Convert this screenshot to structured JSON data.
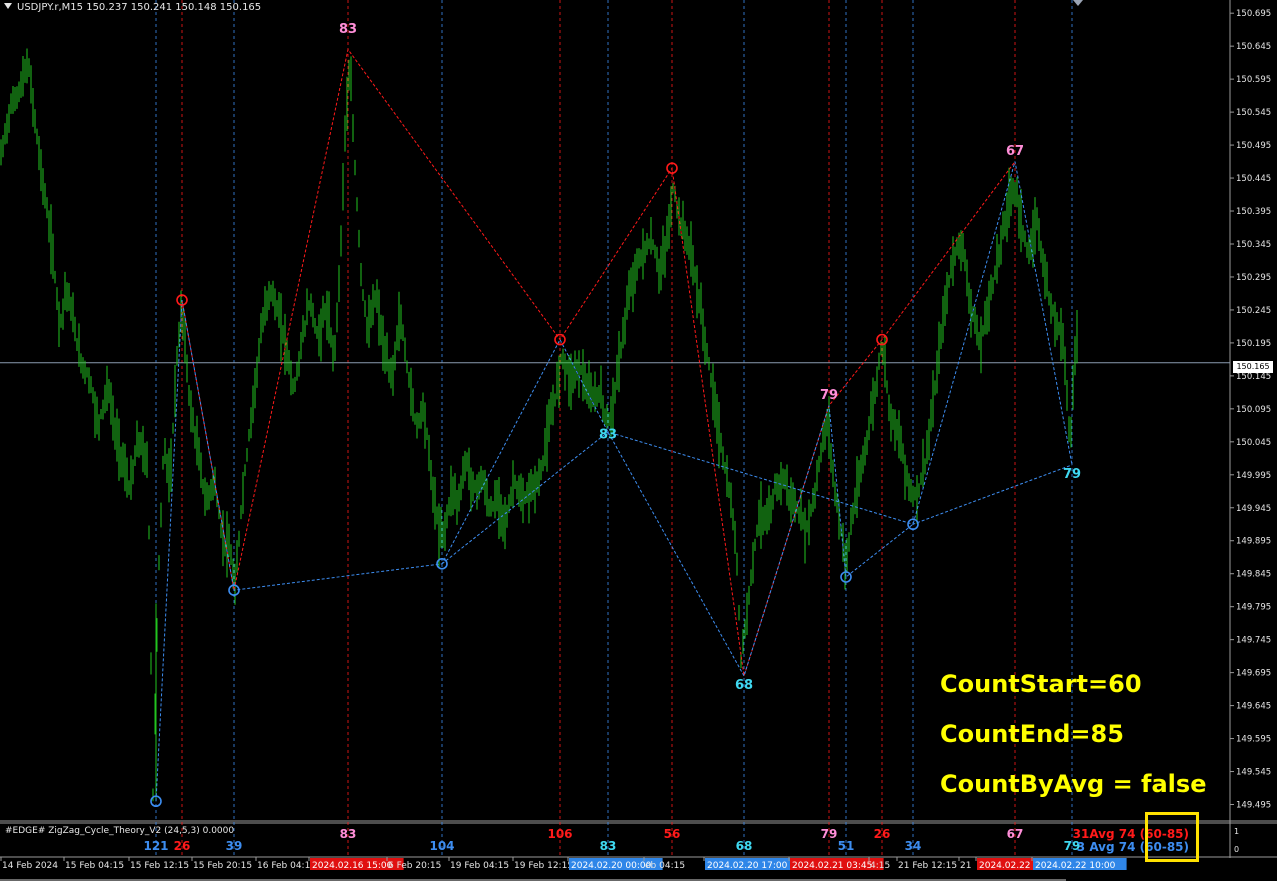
{
  "symbol": "USDJPY.r,M15  150.237 150.241 150.148 150.165",
  "indicator_title": "#EDGE# ZigZag_Cycle_Theory_V2 (24,5,3) 0.0000",
  "current_price": "150.165",
  "settings": {
    "count_start": "CountStart=60",
    "count_end": "CountEnd=85",
    "count_by_avg": "CountByAvg = false"
  },
  "averages": {
    "red": "31Avg 74 (60-85)",
    "blue": "3  Avg 74 (60-85)"
  },
  "colors": {
    "background": "#000000",
    "candles": "#22c31f",
    "red_marker": "#ff1a1a",
    "blue_marker": "#3d8df0",
    "pink_label": "#ff8ed8",
    "cyan_label": "#3fd8f0",
    "settings_text": "#ffff00",
    "highlight_box": "#ffe100"
  },
  "chart_data": {
    "type": "candlestick",
    "timeframe": "M15",
    "ylim": [
      149.47,
      150.715
    ],
    "yticks": [
      "150.695",
      "150.645",
      "150.595",
      "150.545",
      "150.495",
      "150.445",
      "150.395",
      "150.345",
      "150.295",
      "150.245",
      "150.195",
      "150.145",
      "150.095",
      "150.045",
      "149.995",
      "149.945",
      "149.895",
      "149.845",
      "149.795",
      "149.745",
      "149.695",
      "149.645",
      "149.595",
      "149.545",
      "149.495"
    ],
    "x_range": [
      0,
      1230
    ],
    "time_labels": [
      {
        "x": 2,
        "text": "14 Feb 2024",
        "style": "plain"
      },
      {
        "x": 65,
        "text": "15 Feb 04:15",
        "style": "plain"
      },
      {
        "x": 130,
        "text": "15 Feb 12:15",
        "style": "plain"
      },
      {
        "x": 193,
        "text": "15 Feb 20:15",
        "style": "plain"
      },
      {
        "x": 257,
        "text": "16 Feb 04:1",
        "style": "plain"
      },
      {
        "x": 310,
        "text": "2024.02.16 15:00",
        "style": "red"
      },
      {
        "x": 388,
        "text": "6 Feb 20:15",
        "style": "plain"
      },
      {
        "x": 450,
        "text": "19 Feb 04:15",
        "style": "plain"
      },
      {
        "x": 514,
        "text": "19 Feb 12:15",
        "style": "plain"
      },
      {
        "x": 569,
        "text": "2024.02.20 00:00",
        "style": "blue"
      },
      {
        "x": 645,
        "text": "eb 04:15",
        "style": "plain"
      },
      {
        "x": 705,
        "text": "2024.02.20 17:00",
        "style": "blue"
      },
      {
        "x": 790,
        "text": "2024.02.21 03:45",
        "style": "red"
      },
      {
        "x": 870,
        "text": "4:15",
        "style": "plain"
      },
      {
        "x": 898,
        "text": "21 Feb 12:15",
        "style": "plain"
      },
      {
        "x": 960,
        "text": "21",
        "style": "plain"
      },
      {
        "x": 977,
        "text": "2024.02.22",
        "style": "red"
      },
      {
        "x": 1033,
        "text": "2024.02.22 10:00",
        "style": "blue"
      }
    ],
    "price_path": [
      [
        0,
        150.47
      ],
      [
        10,
        150.55
      ],
      [
        20,
        150.58
      ],
      [
        28,
        150.62
      ],
      [
        40,
        150.47
      ],
      [
        52,
        150.34
      ],
      [
        60,
        150.22
      ],
      [
        66,
        150.28
      ],
      [
        72,
        150.24
      ],
      [
        80,
        150.17
      ],
      [
        90,
        150.14
      ],
      [
        98,
        150.07
      ],
      [
        108,
        150.13
      ],
      [
        115,
        150.06
      ],
      [
        122,
        150.02
      ],
      [
        130,
        149.97
      ],
      [
        138,
        150.05
      ],
      [
        148,
        150.01
      ],
      [
        153,
        149.51
      ],
      [
        158,
        149.82
      ],
      [
        164,
        150.05
      ],
      [
        170,
        149.97
      ],
      [
        176,
        150.16
      ],
      [
        182,
        150.25
      ],
      [
        190,
        150.1
      ],
      [
        198,
        150.03
      ],
      [
        206,
        149.95
      ],
      [
        214,
        149.99
      ],
      [
        222,
        149.9
      ],
      [
        230,
        149.88
      ],
      [
        235,
        149.82
      ],
      [
        242,
        149.96
      ],
      [
        248,
        150.04
      ],
      [
        254,
        150.12
      ],
      [
        262,
        150.22
      ],
      [
        270,
        150.28
      ],
      [
        278,
        150.24
      ],
      [
        286,
        150.19
      ],
      [
        294,
        150.12
      ],
      [
        302,
        150.2
      ],
      [
        310,
        150.26
      ],
      [
        318,
        150.2
      ],
      [
        326,
        150.25
      ],
      [
        334,
        150.17
      ],
      [
        340,
        150.31
      ],
      [
        345,
        150.52
      ],
      [
        350,
        150.61
      ],
      [
        356,
        150.43
      ],
      [
        362,
        150.28
      ],
      [
        368,
        150.21
      ],
      [
        376,
        150.27
      ],
      [
        384,
        150.18
      ],
      [
        392,
        150.14
      ],
      [
        400,
        150.24
      ],
      [
        408,
        150.15
      ],
      [
        416,
        150.07
      ],
      [
        424,
        150.1
      ],
      [
        432,
        149.98
      ],
      [
        440,
        149.9
      ],
      [
        446,
        149.92
      ],
      [
        452,
        149.98
      ],
      [
        458,
        149.95
      ],
      [
        466,
        150.02
      ],
      [
        474,
        149.97
      ],
      [
        482,
        149.99
      ],
      [
        490,
        149.94
      ],
      [
        498,
        149.96
      ],
      [
        506,
        149.92
      ],
      [
        514,
        149.99
      ],
      [
        522,
        149.95
      ],
      [
        530,
        149.97
      ],
      [
        540,
        149.99
      ],
      [
        548,
        150.06
      ],
      [
        556,
        150.12
      ],
      [
        562,
        150.18
      ],
      [
        570,
        150.14
      ],
      [
        580,
        150.16
      ],
      [
        590,
        150.11
      ],
      [
        600,
        150.12
      ],
      [
        608,
        150.07
      ],
      [
        616,
        150.13
      ],
      [
        624,
        150.22
      ],
      [
        632,
        150.29
      ],
      [
        642,
        150.33
      ],
      [
        652,
        150.35
      ],
      [
        660,
        150.3
      ],
      [
        668,
        150.36
      ],
      [
        673,
        150.43
      ],
      [
        680,
        150.38
      ],
      [
        690,
        150.34
      ],
      [
        698,
        150.27
      ],
      [
        706,
        150.19
      ],
      [
        714,
        150.11
      ],
      [
        722,
        150.03
      ],
      [
        730,
        149.96
      ],
      [
        736,
        149.89
      ],
      [
        741,
        149.72
      ],
      [
        746,
        149.77
      ],
      [
        752,
        149.86
      ],
      [
        760,
        149.94
      ],
      [
        768,
        149.92
      ],
      [
        776,
        149.98
      ],
      [
        784,
        149.99
      ],
      [
        790,
        149.96
      ],
      [
        798,
        149.94
      ],
      [
        806,
        149.91
      ],
      [
        814,
        149.96
      ],
      [
        822,
        150.04
      ],
      [
        828,
        150.08
      ],
      [
        834,
        149.98
      ],
      [
        840,
        149.92
      ],
      [
        846,
        149.86
      ],
      [
        852,
        149.93
      ],
      [
        860,
        149.99
      ],
      [
        868,
        150.06
      ],
      [
        876,
        150.13
      ],
      [
        882,
        150.2
      ],
      [
        890,
        150.09
      ],
      [
        898,
        150.06
      ],
      [
        906,
        150.0
      ],
      [
        913,
        149.96
      ],
      [
        918,
        149.97
      ],
      [
        926,
        150.02
      ],
      [
        934,
        150.11
      ],
      [
        942,
        150.22
      ],
      [
        950,
        150.3
      ],
      [
        958,
        150.35
      ],
      [
        964,
        150.33
      ],
      [
        972,
        150.24
      ],
      [
        980,
        150.19
      ],
      [
        988,
        150.25
      ],
      [
        996,
        150.31
      ],
      [
        1004,
        150.37
      ],
      [
        1010,
        150.42
      ],
      [
        1016,
        150.43
      ],
      [
        1022,
        150.37
      ],
      [
        1030,
        150.32
      ],
      [
        1036,
        150.39
      ],
      [
        1042,
        150.33
      ],
      [
        1048,
        150.27
      ],
      [
        1056,
        150.23
      ],
      [
        1064,
        150.2
      ],
      [
        1070,
        150.03
      ],
      [
        1074,
        150.16
      ],
      [
        1078,
        150.22
      ]
    ],
    "zigzag_red": [
      [
        182,
        150.26
      ],
      [
        234,
        149.82
      ],
      [
        348,
        150.64
      ],
      [
        560,
        150.2
      ],
      [
        672,
        150.46
      ],
      [
        744,
        149.69
      ],
      [
        829,
        150.1
      ],
      [
        882,
        150.2
      ],
      [
        1015,
        150.47
      ]
    ],
    "zigzag_blue": [
      [
        156,
        149.5
      ],
      [
        182,
        150.26
      ],
      [
        234,
        149.82
      ],
      [
        442,
        149.86
      ],
      [
        560,
        150.2
      ],
      [
        608,
        150.06
      ],
      [
        744,
        149.69
      ],
      [
        829,
        150.1
      ],
      [
        846,
        149.84
      ],
      [
        913,
        149.92
      ],
      [
        1015,
        150.47
      ],
      [
        1072,
        150.01
      ]
    ],
    "blue_bottom_line": [
      [
        442,
        149.86
      ],
      [
        608,
        150.06
      ],
      [
        913,
        149.92
      ],
      [
        1072,
        150.01
      ]
    ],
    "circles": [
      {
        "x": 182,
        "y": 150.26,
        "color": "red"
      },
      {
        "x": 560,
        "y": 150.2,
        "color": "red"
      },
      {
        "x": 672,
        "y": 150.46,
        "color": "red"
      },
      {
        "x": 882,
        "y": 150.2,
        "color": "red"
      },
      {
        "x": 234,
        "y": 149.82,
        "color": "blue"
      },
      {
        "x": 442,
        "y": 149.86,
        "color": "blue"
      },
      {
        "x": 846,
        "y": 149.84,
        "color": "blue"
      },
      {
        "x": 913,
        "y": 149.92,
        "color": "blue"
      },
      {
        "x": 156,
        "y": 149.5,
        "color": "blue"
      }
    ],
    "point_labels": [
      {
        "x": 348,
        "y": 150.665,
        "text": "83",
        "color": "pink"
      },
      {
        "x": 829,
        "y": 150.11,
        "text": "79",
        "color": "pink"
      },
      {
        "x": 1015,
        "y": 150.48,
        "text": "67",
        "color": "pink"
      },
      {
        "x": 608,
        "y": 150.05,
        "text": "83",
        "color": "cyan"
      },
      {
        "x": 744,
        "y": 149.67,
        "text": "68",
        "color": "cyan"
      },
      {
        "x": 1072,
        "y": 149.99,
        "text": "79",
        "color": "cyan"
      }
    ],
    "vlines": [
      {
        "x": 156,
        "color": "blue"
      },
      {
        "x": 182,
        "color": "red"
      },
      {
        "x": 234,
        "color": "blue"
      },
      {
        "x": 348,
        "color": "red"
      },
      {
        "x": 442,
        "color": "blue"
      },
      {
        "x": 560,
        "color": "red"
      },
      {
        "x": 608,
        "color": "blue"
      },
      {
        "x": 672,
        "color": "red"
      },
      {
        "x": 744,
        "color": "blue"
      },
      {
        "x": 829,
        "color": "red"
      },
      {
        "x": 846,
        "color": "blue"
      },
      {
        "x": 882,
        "color": "red"
      },
      {
        "x": 913,
        "color": "blue"
      },
      {
        "x": 1015,
        "color": "red"
      },
      {
        "x": 1072,
        "color": "blue"
      }
    ],
    "indicator_counts": [
      {
        "x": 156,
        "text": "121",
        "color": "blue",
        "row": "low"
      },
      {
        "x": 182,
        "text": "26",
        "color": "red",
        "row": "low"
      },
      {
        "x": 234,
        "text": "39",
        "color": "blue",
        "row": "low"
      },
      {
        "x": 348,
        "text": "83",
        "color": "pink",
        "row": "high"
      },
      {
        "x": 442,
        "text": "104",
        "color": "blue",
        "row": "low"
      },
      {
        "x": 560,
        "text": "106",
        "color": "red",
        "row": "high"
      },
      {
        "x": 608,
        "text": "83",
        "color": "cyan",
        "row": "low"
      },
      {
        "x": 672,
        "text": "56",
        "color": "red",
        "row": "high"
      },
      {
        "x": 744,
        "text": "68",
        "color": "cyan",
        "row": "low"
      },
      {
        "x": 829,
        "text": "79",
        "color": "pink",
        "row": "high"
      },
      {
        "x": 846,
        "text": "51",
        "color": "blue",
        "row": "low"
      },
      {
        "x": 882,
        "text": "26",
        "color": "red",
        "row": "high"
      },
      {
        "x": 913,
        "text": "34",
        "color": "blue",
        "row": "low"
      },
      {
        "x": 1015,
        "text": "67",
        "color": "pink",
        "row": "high"
      },
      {
        "x": 1072,
        "text": "79",
        "color": "cyan",
        "row": "low"
      }
    ],
    "indicator_scale": [
      "1",
      "0"
    ],
    "grid": false
  }
}
